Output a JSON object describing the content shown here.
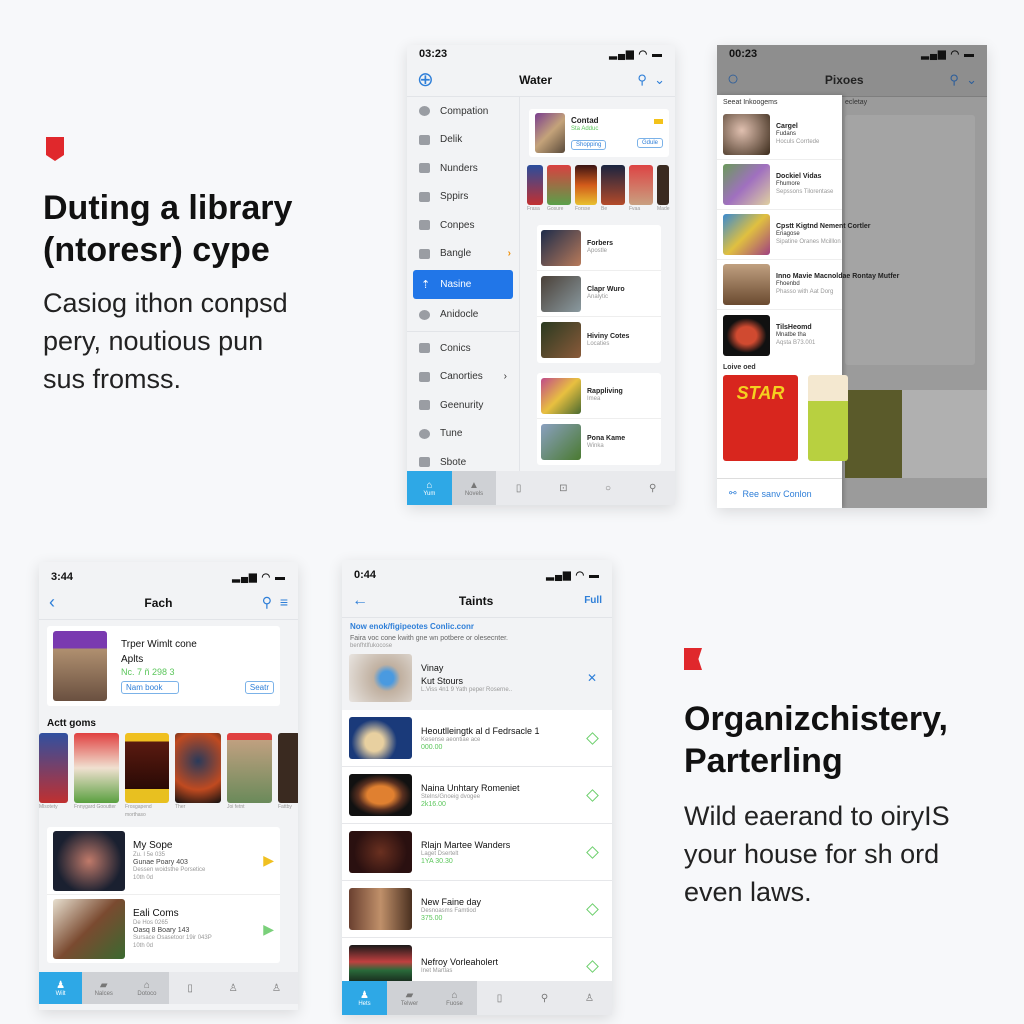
{
  "left_text": {
    "heading": [
      "Duting a library",
      "(ntoresr) cype"
    ],
    "body": [
      "Casiog ithon conpsd",
      "pery, noutious pun",
      "sus fromss."
    ]
  },
  "right_text": {
    "heading": [
      "Organizchistery,",
      "Parterling"
    ],
    "body": [
      "Wild eaerand to oiryIS",
      "your house for sh ord",
      "even laws."
    ]
  },
  "colors": {
    "accent": "#2176e8",
    "badge": "#e0282c",
    "price": "#5bc65b",
    "tab_active": "#2ea8e6"
  },
  "phone1": {
    "time": "03:23",
    "title": "Water",
    "sidebar": [
      "Compation",
      "Delik",
      "Nunders",
      "Sppirs",
      "Conpes",
      "Bangle",
      "Nasine",
      "Anidocle",
      "Conics",
      "Canorties",
      "Geenurity",
      "Tune",
      "Sbote"
    ],
    "featured": {
      "title": "Contad",
      "subtitle": "Sta Adduc",
      "field": "Shopping",
      "button": "Gdule"
    },
    "covers": [
      "Frasa",
      "Gosure",
      "Forsse",
      "Be",
      "Fvaa",
      "Made"
    ],
    "items": [
      {
        "title": "Forbers",
        "sub": "Apostle"
      },
      {
        "title": "Clapr Wuro",
        "sub": "Analytic"
      },
      {
        "title": "Hiviny Cotes",
        "sub": "Locaties"
      },
      {
        "title": "Rappliving",
        "sub": "Imea"
      },
      {
        "title": "Pona Kame",
        "sub": "Winka"
      }
    ],
    "tabs": [
      "Yum",
      "Novels",
      "",
      "",
      "",
      ""
    ]
  },
  "phone2": {
    "time": "00:23",
    "title": "Pixoes",
    "behind_label": "ecletay",
    "drawer_heading": "Seeat Inkoogems",
    "items": [
      {
        "title": "Cargel",
        "sub": "Fudans",
        "meta": "Hoculs Corrtede"
      },
      {
        "title": "Dockiel Vidas",
        "sub": "Fhumore",
        "meta": "Sepssons Tilorentase"
      },
      {
        "title": "Cpstt Kigtnd Nement Cortler",
        "sub": "Eriagose",
        "meta": "Sipatine Oranes Mcilllon"
      },
      {
        "title": "Inno Mavie Macnoldae Rontay Mutfer",
        "sub": "Fhoenbd",
        "meta": "Phasso with Aat Dorg"
      },
      {
        "title": "TilsHeomd",
        "sub": "Mnatbe tha",
        "meta": "Aqsta B73.001"
      }
    ],
    "section": "Loive oed",
    "cover_text": "STAR",
    "link": "Ree sanv Conlon"
  },
  "phone3": {
    "time": "3:44",
    "title": "Fach",
    "featured": {
      "title": "Trper Wimlt cone",
      "subtitle": "Aplts",
      "price": "Nc. 7 ñ 298 3",
      "field": "Nam book",
      "button": "Seatr"
    },
    "section": "Actt goms",
    "covers": [
      "Mlsotety",
      "Fnnygard Gooutter",
      "Frosgapend morthaso",
      "Ther",
      "Joi fetnt",
      "Fattby"
    ],
    "items": [
      {
        "title": "My Sope",
        "l1": "Zu. I 5e 035",
        "l2": "Gunae Poary 403",
        "l3": "Dessen woidsthe Porsetice",
        "l4": "10th 0d"
      },
      {
        "title": "Eali Coms",
        "l1": "De Hos 0265",
        "l2": "Oasq 8 Boary 143",
        "l3": "Sursace Osasetoor 19ir 043P",
        "l4": "10th 0d"
      }
    ],
    "tabs": [
      "Wilt",
      "Nalces",
      "Dotoco",
      "",
      "",
      ""
    ]
  },
  "phone4": {
    "time": "0:44",
    "title": "Taints",
    "action": "Full",
    "banner_link": "Now enok/figipeotes Conlic.conr",
    "banner_text": "Faira voc cone kwith gne wn potbere or olesecnter.",
    "banner_sub": "benfhtlfukocose",
    "highlight": {
      "l1": "Vinay",
      "l2": "Kut Stours",
      "l3": "L.Viss 4n1 9 Yath peper Roserne.."
    },
    "items": [
      {
        "title": "Heoutlleingtk al d Fedrsacle  1",
        "sub": "Kesense aeontiae ace",
        "price": "000.00"
      },
      {
        "title": "Naina Unhtary Romeniet",
        "sub": "Stelns/Gnoeig dvogee",
        "price": "2k16.00"
      },
      {
        "title": "Rlajn Martee Wanders",
        "sub": "Laget Dsertelt",
        "price": "1YA 30.30"
      },
      {
        "title": "New Faine day",
        "sub": "Desnoasms Famtiod",
        "price": "375.00"
      },
      {
        "title": "Nefroy Vorleaholert",
        "sub": "Inet Martlas",
        "price": ""
      }
    ],
    "tabs": [
      "Hets",
      "Telwer",
      "Fuose",
      "",
      "",
      ""
    ]
  }
}
